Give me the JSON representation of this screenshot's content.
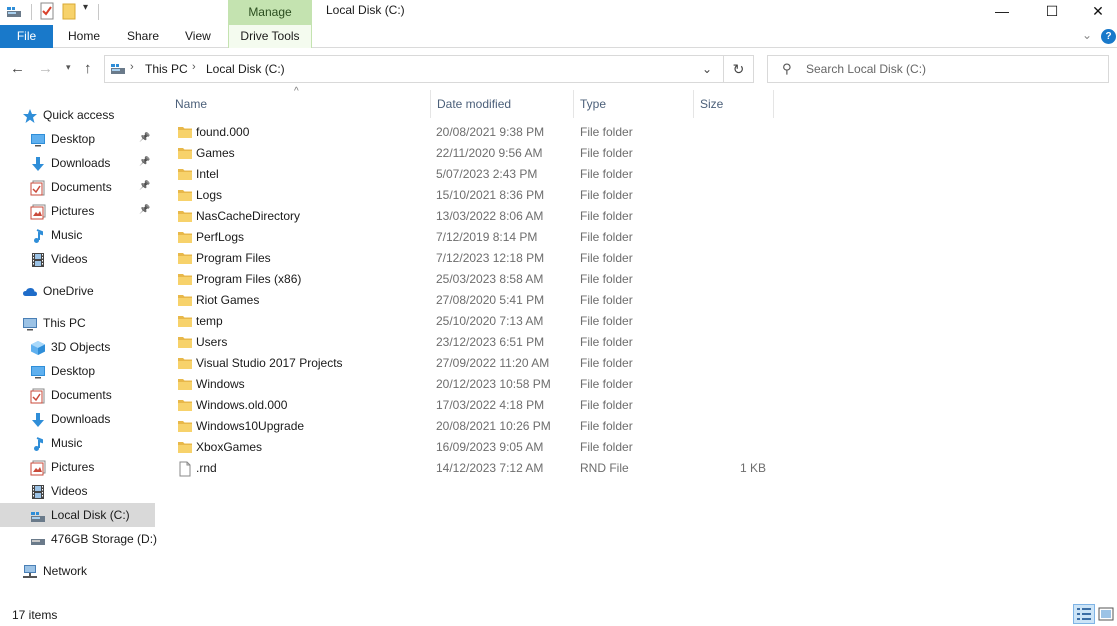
{
  "window": {
    "title": "Local Disk (C:)",
    "manage_tab": "Manage",
    "minimize": "—",
    "maximize": "☐",
    "close": "✕"
  },
  "ribbon": {
    "file": "File",
    "home": "Home",
    "share": "Share",
    "view": "View",
    "drive_tools": "Drive Tools",
    "help": "?"
  },
  "address": {
    "crumbs": [
      "This PC",
      "Local Disk (C:)"
    ]
  },
  "search": {
    "placeholder": "Search Local Disk (C:)"
  },
  "nav": {
    "items": [
      {
        "label": "Quick access",
        "icon": "star-icon",
        "indent": 0,
        "pinned": false
      },
      {
        "label": "Desktop",
        "icon": "desktop-icon",
        "indent": 1,
        "pinned": true
      },
      {
        "label": "Downloads",
        "icon": "download-icon",
        "indent": 1,
        "pinned": true
      },
      {
        "label": "Documents",
        "icon": "documents-icon",
        "indent": 1,
        "pinned": true
      },
      {
        "label": "Pictures",
        "icon": "pictures-icon",
        "indent": 1,
        "pinned": true
      },
      {
        "label": "Music",
        "icon": "music-icon",
        "indent": 1,
        "pinned": false
      },
      {
        "label": "Videos",
        "icon": "videos-icon",
        "indent": 1,
        "pinned": false
      },
      {
        "label": "OneDrive",
        "icon": "cloud-icon",
        "indent": 0,
        "pinned": false
      },
      {
        "label": "This PC",
        "icon": "computer-icon",
        "indent": 0,
        "pinned": false
      },
      {
        "label": "3D Objects",
        "icon": "cube-icon",
        "indent": 1,
        "pinned": false
      },
      {
        "label": "Desktop",
        "icon": "desktop-icon",
        "indent": 1,
        "pinned": false
      },
      {
        "label": "Documents",
        "icon": "documents-icon",
        "indent": 1,
        "pinned": false
      },
      {
        "label": "Downloads",
        "icon": "download-icon",
        "indent": 1,
        "pinned": false
      },
      {
        "label": "Music",
        "icon": "music-icon",
        "indent": 1,
        "pinned": false
      },
      {
        "label": "Pictures",
        "icon": "pictures-icon",
        "indent": 1,
        "pinned": false
      },
      {
        "label": "Videos",
        "icon": "videos-icon",
        "indent": 1,
        "pinned": false
      },
      {
        "label": "Local Disk (C:)",
        "icon": "drive-icon",
        "indent": 1,
        "pinned": false,
        "selected": true
      },
      {
        "label": "476GB Storage (D:)",
        "icon": "drive-icon",
        "indent": 1,
        "pinned": false
      },
      {
        "label": "Network",
        "icon": "network-icon",
        "indent": 0,
        "pinned": false
      }
    ]
  },
  "columns": {
    "name": "Name",
    "date": "Date modified",
    "type": "Type",
    "size": "Size"
  },
  "files": [
    {
      "name": "found.000",
      "date": "20/08/2021 9:38 PM",
      "type": "File folder",
      "size": "",
      "kind": "folder"
    },
    {
      "name": "Games",
      "date": "22/11/2020 9:56 AM",
      "type": "File folder",
      "size": "",
      "kind": "folder"
    },
    {
      "name": "Intel",
      "date": "5/07/2023 2:43 PM",
      "type": "File folder",
      "size": "",
      "kind": "folder"
    },
    {
      "name": "Logs",
      "date": "15/10/2021 8:36 PM",
      "type": "File folder",
      "size": "",
      "kind": "folder"
    },
    {
      "name": "NasCacheDirectory",
      "date": "13/03/2022 8:06 AM",
      "type": "File folder",
      "size": "",
      "kind": "folder"
    },
    {
      "name": "PerfLogs",
      "date": "7/12/2019 8:14 PM",
      "type": "File folder",
      "size": "",
      "kind": "folder"
    },
    {
      "name": "Program Files",
      "date": "7/12/2023 12:18 PM",
      "type": "File folder",
      "size": "",
      "kind": "folder"
    },
    {
      "name": "Program Files (x86)",
      "date": "25/03/2023 8:58 AM",
      "type": "File folder",
      "size": "",
      "kind": "folder"
    },
    {
      "name": "Riot Games",
      "date": "27/08/2020 5:41 PM",
      "type": "File folder",
      "size": "",
      "kind": "folder"
    },
    {
      "name": "temp",
      "date": "25/10/2020 7:13 AM",
      "type": "File folder",
      "size": "",
      "kind": "folder"
    },
    {
      "name": "Users",
      "date": "23/12/2023 6:51 PM",
      "type": "File folder",
      "size": "",
      "kind": "folder"
    },
    {
      "name": "Visual Studio 2017 Projects",
      "date": "27/09/2022 11:20 AM",
      "type": "File folder",
      "size": "",
      "kind": "folder"
    },
    {
      "name": "Windows",
      "date": "20/12/2023 10:58 PM",
      "type": "File folder",
      "size": "",
      "kind": "folder"
    },
    {
      "name": "Windows.old.000",
      "date": "17/03/2022 4:18 PM",
      "type": "File folder",
      "size": "",
      "kind": "folder"
    },
    {
      "name": "Windows10Upgrade",
      "date": "20/08/2021 10:26 PM",
      "type": "File folder",
      "size": "",
      "kind": "folder"
    },
    {
      "name": "XboxGames",
      "date": "16/09/2023 9:05 AM",
      "type": "File folder",
      "size": "",
      "kind": "folder"
    },
    {
      "name": ".rnd",
      "date": "14/12/2023 7:12 AM",
      "type": "RND File",
      "size": "1 KB",
      "kind": "file"
    }
  ],
  "status": {
    "count": "17 items"
  },
  "colors": {
    "accent": "#1979ca",
    "manage_tab": "#c4e3b0",
    "folder": "#f7d26b",
    "selected": "#d9d9d9"
  }
}
